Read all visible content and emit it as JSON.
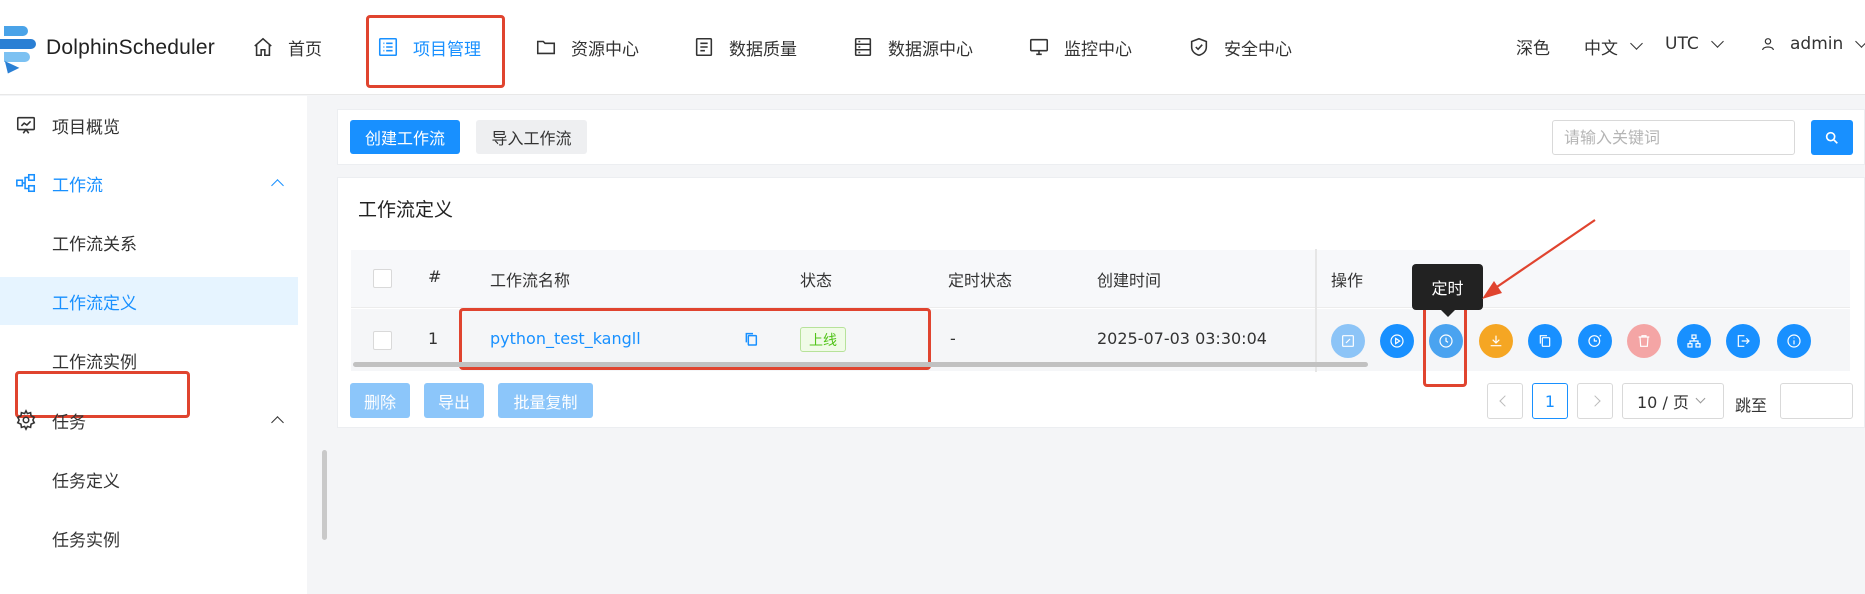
{
  "header": {
    "logo_text": "DolphinScheduler",
    "nav": [
      {
        "label": "首页",
        "icon": "home-icon"
      },
      {
        "label": "项目管理",
        "icon": "list-icon"
      },
      {
        "label": "资源中心",
        "icon": "folder-icon"
      },
      {
        "label": "数据质量",
        "icon": "document-icon"
      },
      {
        "label": "数据源中心",
        "icon": "database-icon"
      },
      {
        "label": "监控中心",
        "icon": "monitor-icon"
      },
      {
        "label": "安全中心",
        "icon": "shield-icon"
      }
    ],
    "theme_label": "深色",
    "language": "中文",
    "timezone": "UTC",
    "user": "admin"
  },
  "sidebar": {
    "items": [
      {
        "label": "项目概览",
        "icon": "chart-board-icon"
      },
      {
        "label": "工作流",
        "icon": "workflow-icon"
      },
      {
        "label": "工作流关系"
      },
      {
        "label": "工作流定义"
      },
      {
        "label": "工作流实例"
      },
      {
        "label": "任务",
        "icon": "gear-icon"
      },
      {
        "label": "任务定义"
      },
      {
        "label": "任务实例"
      }
    ]
  },
  "toolbar": {
    "create_label": "创建工作流",
    "import_label": "导入工作流",
    "search_placeholder": "请输入关键词"
  },
  "section_title": "工作流定义",
  "table": {
    "columns": [
      "#",
      "工作流名称",
      "状态",
      "定时状态",
      "创建时间",
      "操作"
    ],
    "rows": [
      {
        "index": "1",
        "name": "python_test_kangll",
        "status": "上线",
        "schedule_status": "-",
        "created": "2025-07-03 03:30:04"
      }
    ],
    "operations": [
      {
        "name": "edit",
        "color": "#8cc4f7",
        "icon": "edit-icon"
      },
      {
        "name": "start",
        "color": "#1890ff",
        "icon": "play-icon"
      },
      {
        "name": "timing",
        "color": "#4aa3f0",
        "icon": "clock-icon"
      },
      {
        "name": "download",
        "color": "#f5a623",
        "icon": "download-icon"
      },
      {
        "name": "copy",
        "color": "#1890ff",
        "icon": "copy-icon"
      },
      {
        "name": "timing-manage",
        "color": "#1890ff",
        "icon": "clock-manage-icon"
      },
      {
        "name": "delete",
        "color": "#f4a5a5",
        "icon": "trash-icon"
      },
      {
        "name": "tree",
        "color": "#1890ff",
        "icon": "tree-icon"
      },
      {
        "name": "export",
        "color": "#1890ff",
        "icon": "export-icon"
      },
      {
        "name": "info",
        "color": "#1890ff",
        "icon": "info-icon"
      }
    ],
    "tooltip": "定时"
  },
  "bulk": {
    "delete_label": "删除",
    "export_label": "导出",
    "batch_copy_label": "批量复制"
  },
  "pagination": {
    "current_page": "1",
    "page_size": "10 / 页",
    "jump_label": "跳至"
  },
  "colors": {
    "primary": "#1890ff",
    "highlight_box": "#e0442f"
  }
}
